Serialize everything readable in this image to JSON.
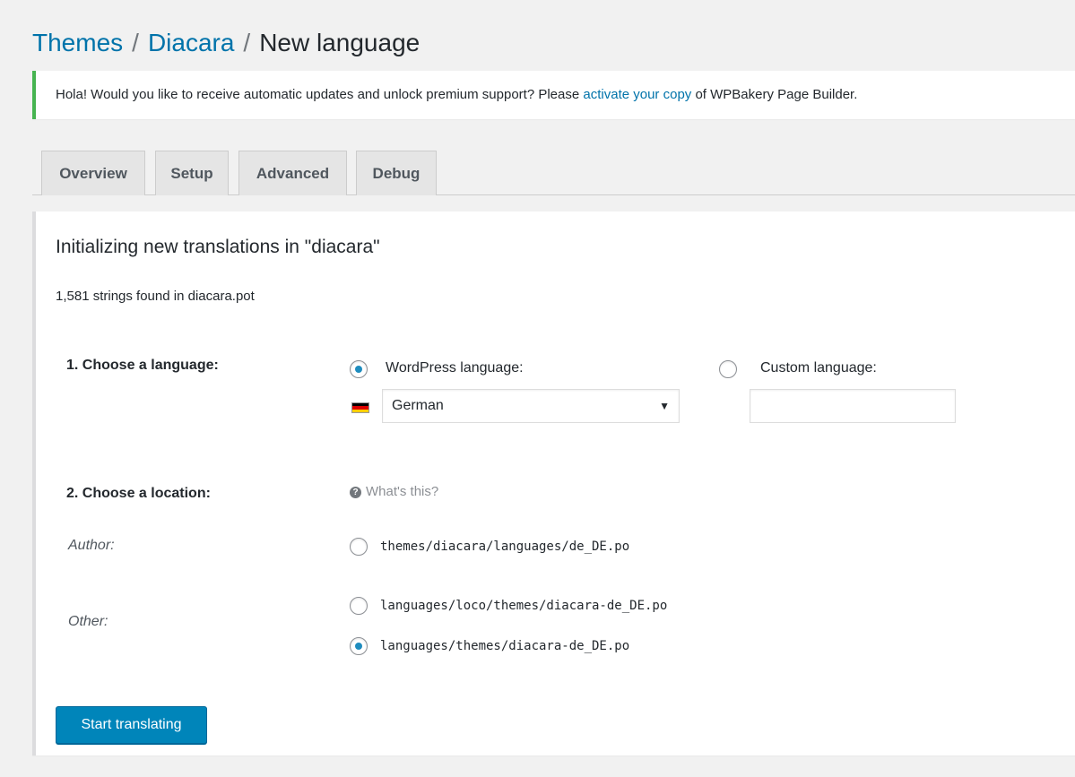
{
  "breadcrumb": {
    "themes": "Themes",
    "theme": "Diacara",
    "current": "New language",
    "separator": "/"
  },
  "notice": {
    "text_before": "Hola! Would you like to receive automatic updates and unlock premium support? Please ",
    "link_text": "activate your copy",
    "text_after": " of WPBakery Page Builder."
  },
  "tabs": [
    {
      "label": "Overview"
    },
    {
      "label": "Setup"
    },
    {
      "label": "Advanced"
    },
    {
      "label": "Debug"
    }
  ],
  "panel": {
    "title": "Initializing new translations in \"diacara\"",
    "subtitle": "1,581 strings found in diacara.pot",
    "step1": {
      "label": "1. Choose a language:",
      "wp_language_label": "WordPress language:",
      "wp_language_checked": true,
      "selected_language": "German",
      "custom_language_label": "Custom language:",
      "custom_language_checked": false,
      "custom_language_value": ""
    },
    "step2": {
      "label": "2. Choose a location:",
      "help_text": "What's this?",
      "author_label": "Author:",
      "author_path": "themes/diacara/languages/de_DE.po",
      "other_label": "Other:",
      "other_path_1": "languages/loco/themes/diacara-de_DE.po",
      "other_path_2": "languages/themes/diacara-de_DE.po"
    },
    "submit_label": "Start translating"
  },
  "colors": {
    "link": "#0073aa",
    "notice_accent": "#46b450",
    "primary_button": "#0085ba",
    "radio_checked": "#1e8cbe"
  },
  "icons": {
    "flag": "germany-flag-icon",
    "help": "question-circle-icon",
    "dropdown": "triangle-down-icon"
  }
}
